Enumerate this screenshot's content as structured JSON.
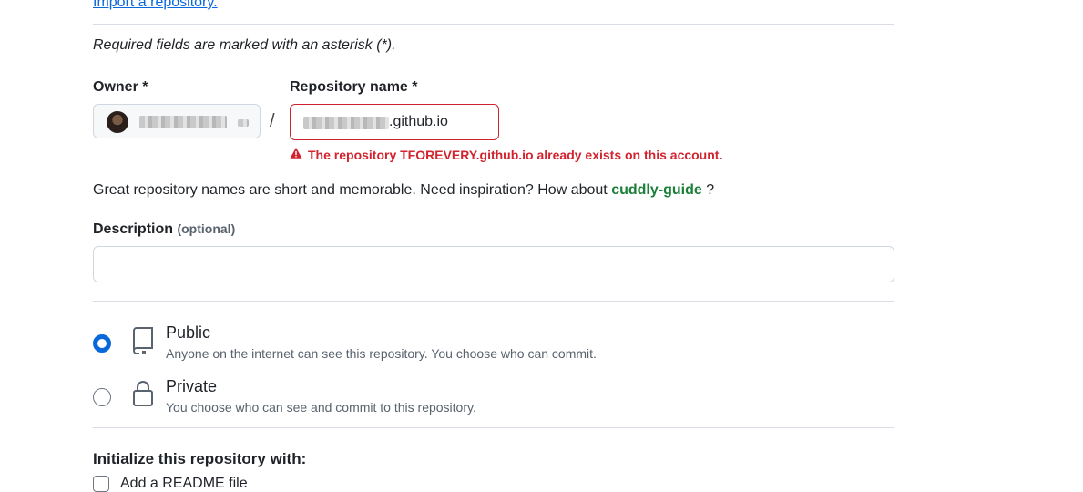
{
  "import_link": "Import a repository.",
  "required_note": "Required fields are marked with an asterisk (*).",
  "owner": {
    "label": "Owner *",
    "name_blurred": true
  },
  "repository_name": {
    "label": "Repository name *",
    "value_suffix": ".github.io",
    "error": "The repository TFOREVERY.github.io already exists on this account."
  },
  "hint": {
    "prefix": "Great repository names are short and memorable. Need inspiration? How about",
    "suggestion": "cuddly-guide",
    "suffix": "?"
  },
  "description": {
    "label": "Description",
    "optional": "(optional)",
    "value": ""
  },
  "visibility": {
    "selected": "public",
    "options": [
      {
        "title": "Public",
        "desc": "Anyone on the internet can see this repository. You choose who can commit.",
        "icon": "repo-icon"
      },
      {
        "title": "Private",
        "desc": "You choose who can see and commit to this repository.",
        "icon": "lock-icon"
      }
    ]
  },
  "initialize": {
    "label": "Initialize this repository with:",
    "readme_label": "Add a README file"
  },
  "colors": {
    "error": "#d1242f",
    "accent": "#0969da",
    "suggestion": "#1a7f37"
  }
}
